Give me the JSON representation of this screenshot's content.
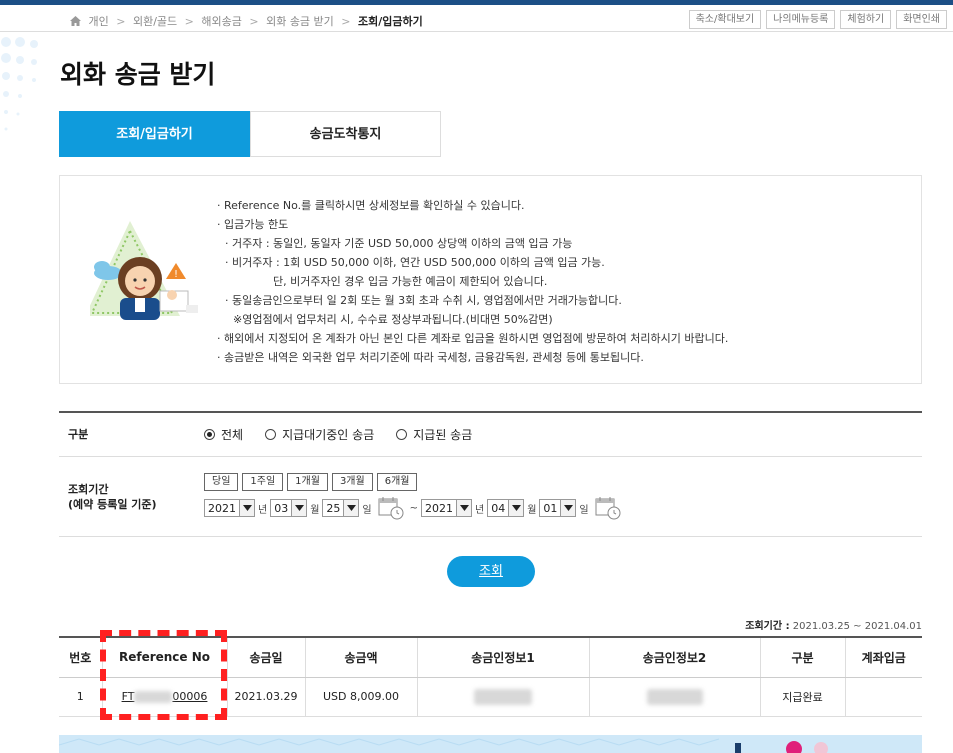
{
  "breadcrumb": {
    "items": [
      "개인",
      "외환/골드",
      "해외송금",
      "외화 송금 받기"
    ],
    "current": "조회/입금하기",
    "separator": ">"
  },
  "util_buttons": [
    "축소/확대보기",
    "나의메뉴등록",
    "체험하기",
    "화면인쇄"
  ],
  "page_title": "외화 송금 받기",
  "tabs": [
    {
      "label": "조회/입금하기",
      "active": true
    },
    {
      "label": "송금도착통지",
      "active": false
    }
  ],
  "notice": {
    "lines": [
      "· Reference No.를 클릭하시면 상세정보를 확인하실 수 있습니다.",
      "· 입금가능 한도",
      "· 거주자 : 동일인, 동일자 기준 USD 50,000 상당액 이하의 금액 입금 가능",
      "· 비거주자 : 1회 USD 50,000 이하, 연간 USD 500,000 이하의 금액 입금 가능.",
      "단, 비거주자인 경우 입금 가능한 예금이 제한되어 있습니다.",
      "· 동일송금인으로부터 일 2회 또는 월 3회 초과 수취 시, 영업점에서만 거래가능합니다.",
      "※영업점에서 업무처리 시, 수수료 정상부과됩니다.(비대면 50%감면)",
      "· 해외에서 지정되어 온 계좌가 아닌 본인 다른 계좌로 입금을 원하시면 영업점에 방문하여 처리하시기 바랍니다.",
      "· 송금받은 내역은 외국환 업무 처리기준에 따라 국세청, 금융감독원, 관세청 등에 통보됩니다."
    ]
  },
  "search": {
    "type_label": "구분",
    "type_options": [
      {
        "label": "전체",
        "selected": true
      },
      {
        "label": "지급대기중인 송금",
        "selected": false
      },
      {
        "label": "지급된 송금",
        "selected": false
      }
    ],
    "period_label_1": "조회기간",
    "period_label_2": "(예약 등록일 기준)",
    "quick_buttons": [
      "당일",
      "1주일",
      "1개월",
      "3개월",
      "6개월"
    ],
    "from": {
      "year": "2021",
      "month": "03",
      "day": "25"
    },
    "to": {
      "year": "2021",
      "month": "04",
      "day": "01"
    },
    "unit_year": "년",
    "unit_month": "월",
    "unit_day": "일",
    "tilde": "~",
    "search_button": "조회"
  },
  "result": {
    "period_label": "조회기간 :",
    "period_value": "2021.03.25 ~ 2021.04.01",
    "columns": [
      "번호",
      "Reference No",
      "송금일",
      "송금액",
      "송금인정보1",
      "송금인정보2",
      "구분",
      "계좌입금"
    ],
    "rows": [
      {
        "no": "1",
        "ref_prefix": "FT",
        "ref_suffix": "00006",
        "date": "2021.03.29",
        "amount": "USD 8,009.00",
        "info1": "",
        "info2": "",
        "status": "지급완료",
        "deposit": ""
      }
    ]
  }
}
